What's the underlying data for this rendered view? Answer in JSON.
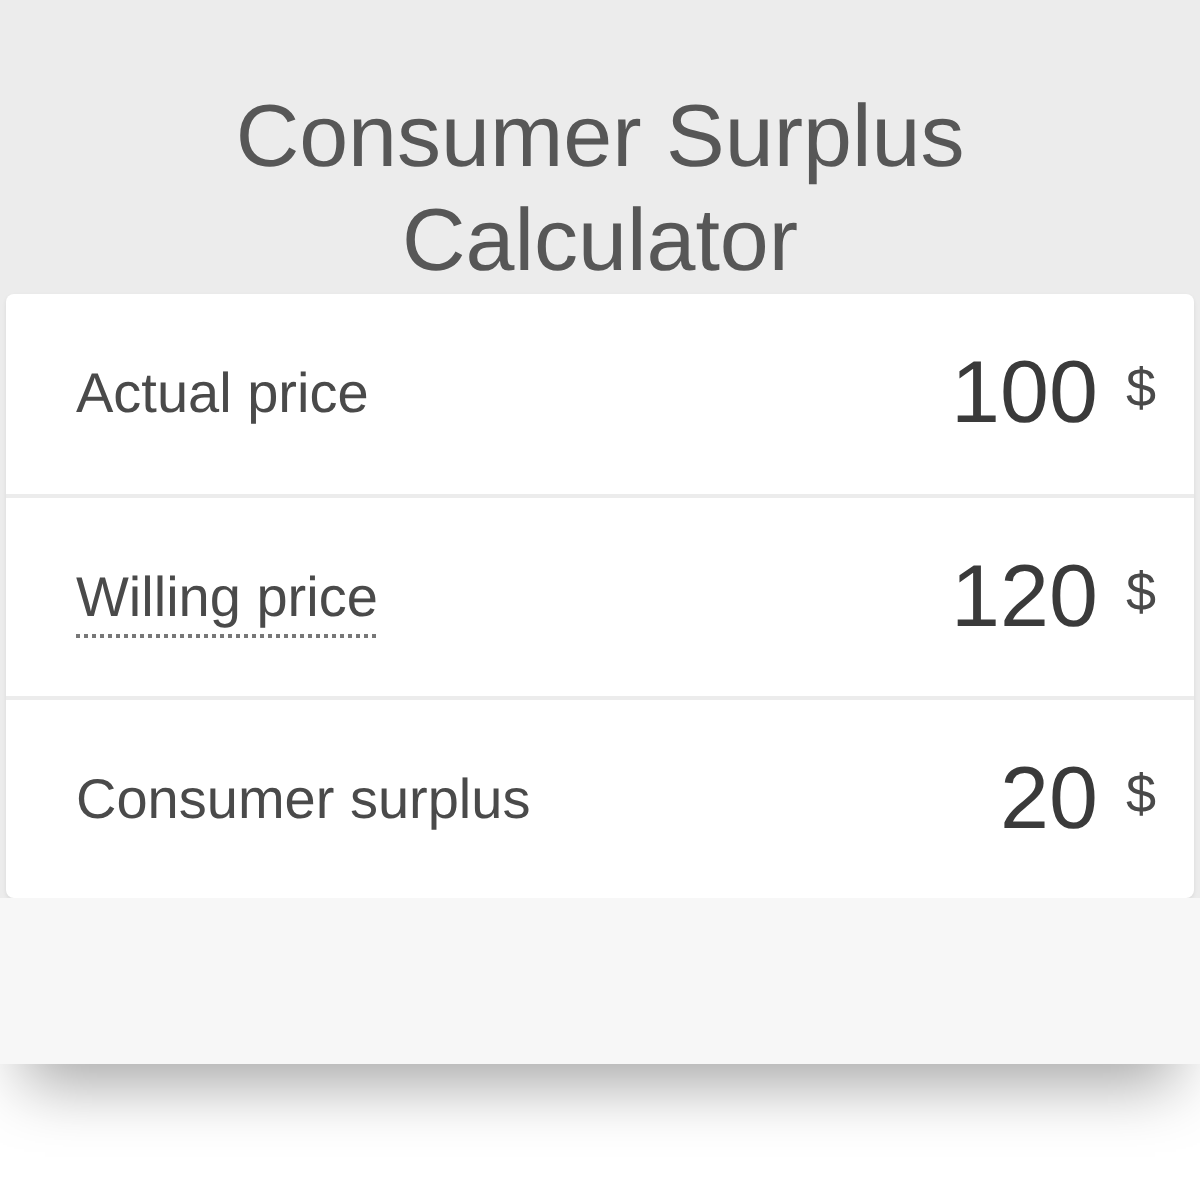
{
  "title": "Consumer Surplus Calculator",
  "fields": [
    {
      "label": "Actual price",
      "kind": "plain",
      "value": "100",
      "unit": "$"
    },
    {
      "label": "Willing price",
      "kind": "hint",
      "value": "120",
      "unit": "$"
    },
    {
      "label": "Consumer surplus",
      "kind": "plain",
      "value": "20",
      "unit": "$"
    }
  ]
}
